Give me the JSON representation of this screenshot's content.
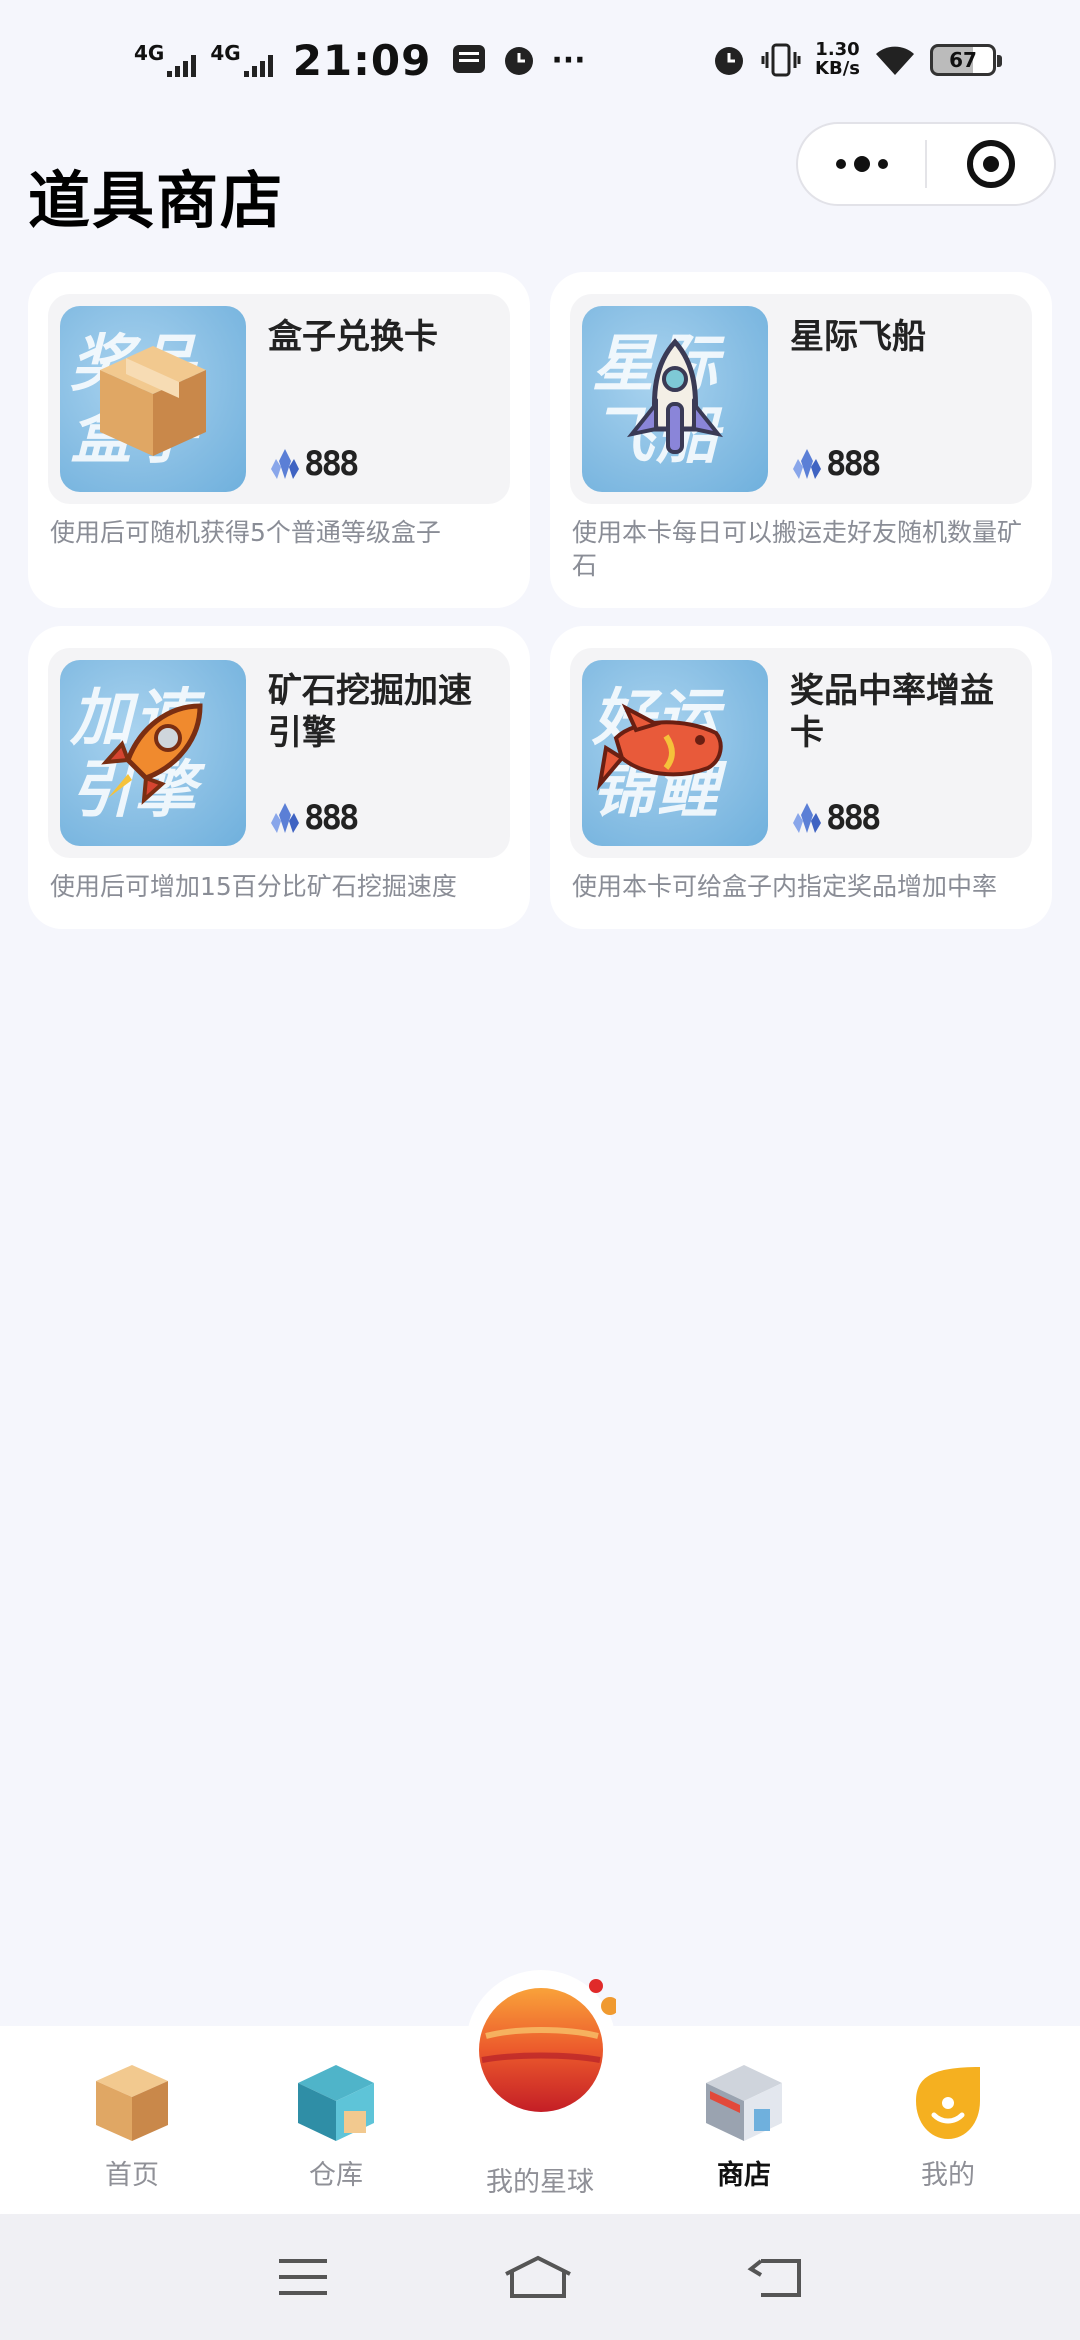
{
  "status_bar": {
    "network_1": "4G",
    "network_2": "4G",
    "time": "21:09",
    "more": "···",
    "speed_value": "1.30",
    "speed_unit": "KB/s",
    "battery": "67"
  },
  "header": {
    "title": "道具商店"
  },
  "items": [
    {
      "name": "盒子兑换卡",
      "thumb_text": "奖品盒子",
      "icon": "box-icon",
      "price": "888",
      "desc": "使用后可随机获得5个普通等级盒子"
    },
    {
      "name": "星际飞船",
      "thumb_text": "星际飞船",
      "icon": "spaceship-icon",
      "price": "888",
      "desc": "使用本卡每日可以搬运走好友随机数量矿石"
    },
    {
      "name": "矿石挖掘加速引擎",
      "thumb_text": "加速引擎",
      "icon": "rocket-icon",
      "price": "888",
      "desc": "使用后可增加15百分比矿石挖掘速度"
    },
    {
      "name": "奖品中率增益卡",
      "thumb_text": "好运锦鲤",
      "icon": "koi-fish-icon",
      "price": "888",
      "desc": "使用本卡可给盒子内指定奖品增加中率"
    }
  ],
  "tabbar": {
    "home": "首页",
    "warehouse": "仓库",
    "planet": "我的星球",
    "shop": "商店",
    "mine": "我的",
    "active": "shop"
  },
  "colors": {
    "page_bg": "#f5f6fc",
    "thumb_bg": "#86bde3",
    "crystal": "#5b7fd6",
    "planet": "#e0402a"
  }
}
